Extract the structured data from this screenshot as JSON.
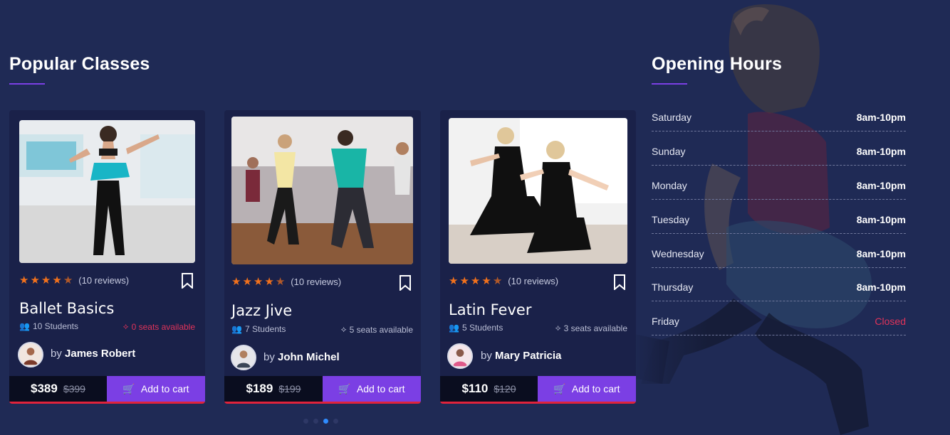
{
  "popular": {
    "title": "Popular Classes",
    "classes": [
      {
        "title": "Ballet Basics",
        "reviews": "(10 reviews)",
        "students": "10 Students",
        "seats": "0 seats available",
        "seats_color": "#e0335a",
        "instructor_prefix": "by",
        "instructor_name": "James Robert",
        "price": "$389",
        "old_price": "$399",
        "cart_label": "Add to cart",
        "rating": 4.5
      },
      {
        "title": "Jazz Jive",
        "reviews": "(10 reviews)",
        "students": "7 Students",
        "seats": "5 seats available",
        "seats_color": "#b9bdd4",
        "instructor_prefix": "by",
        "instructor_name": "John Michel",
        "price": "$189",
        "old_price": "$199",
        "cart_label": "Add to cart",
        "rating": 4.5
      },
      {
        "title": "Latin Fever",
        "reviews": "(10 reviews)",
        "students": "5 Students",
        "seats": "3 seats available",
        "seats_color": "#b9bdd4",
        "instructor_prefix": "by",
        "instructor_name": "Mary Patricia",
        "price": "$110",
        "old_price": "$120",
        "cart_label": "Add to cart",
        "rating": 4.5
      }
    ],
    "active_dot": 2
  },
  "hours": {
    "title": "Opening Hours",
    "rows": [
      {
        "day": "Saturday",
        "time": "8am-10pm"
      },
      {
        "day": "Sunday",
        "time": "8am-10pm"
      },
      {
        "day": "Monday",
        "time": "8am-10pm"
      },
      {
        "day": "Tuesday",
        "time": "8am-10pm"
      },
      {
        "day": "Wednesday",
        "time": "8am-10pm"
      },
      {
        "day": "Thursday",
        "time": "8am-10pm"
      },
      {
        "day": "Friday",
        "time": "Closed"
      }
    ]
  },
  "colors": {
    "background": "#1f2a55",
    "card": "#1a2149",
    "accent": "#7b3fe4",
    "star": "#f2711c",
    "price_underline": "#e0233b",
    "closed": "#e0335a",
    "active_dot": "#2f8cff"
  },
  "icons": [
    "star-icon",
    "bookmark-icon",
    "users-icon",
    "ticket-icon",
    "cart-icon"
  ]
}
